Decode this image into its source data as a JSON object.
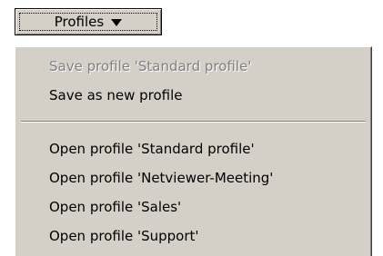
{
  "button": {
    "label": "Profiles",
    "icon": "caret-down-icon"
  },
  "menu": {
    "items": [
      {
        "label": "Save profile 'Standard profile'",
        "enabled": false
      },
      {
        "label": "Save as new profile",
        "enabled": true
      },
      {
        "label": "Open profile 'Standard profile'",
        "enabled": true
      },
      {
        "label": "Open profile 'Netviewer-Meeting'",
        "enabled": true
      },
      {
        "label": "Open profile 'Sales'",
        "enabled": true
      },
      {
        "label": "Open profile 'Support'",
        "enabled": true
      }
    ]
  },
  "colors": {
    "menu_background": "#d4d0c8",
    "text": "#000000",
    "disabled_text": "#808080"
  }
}
